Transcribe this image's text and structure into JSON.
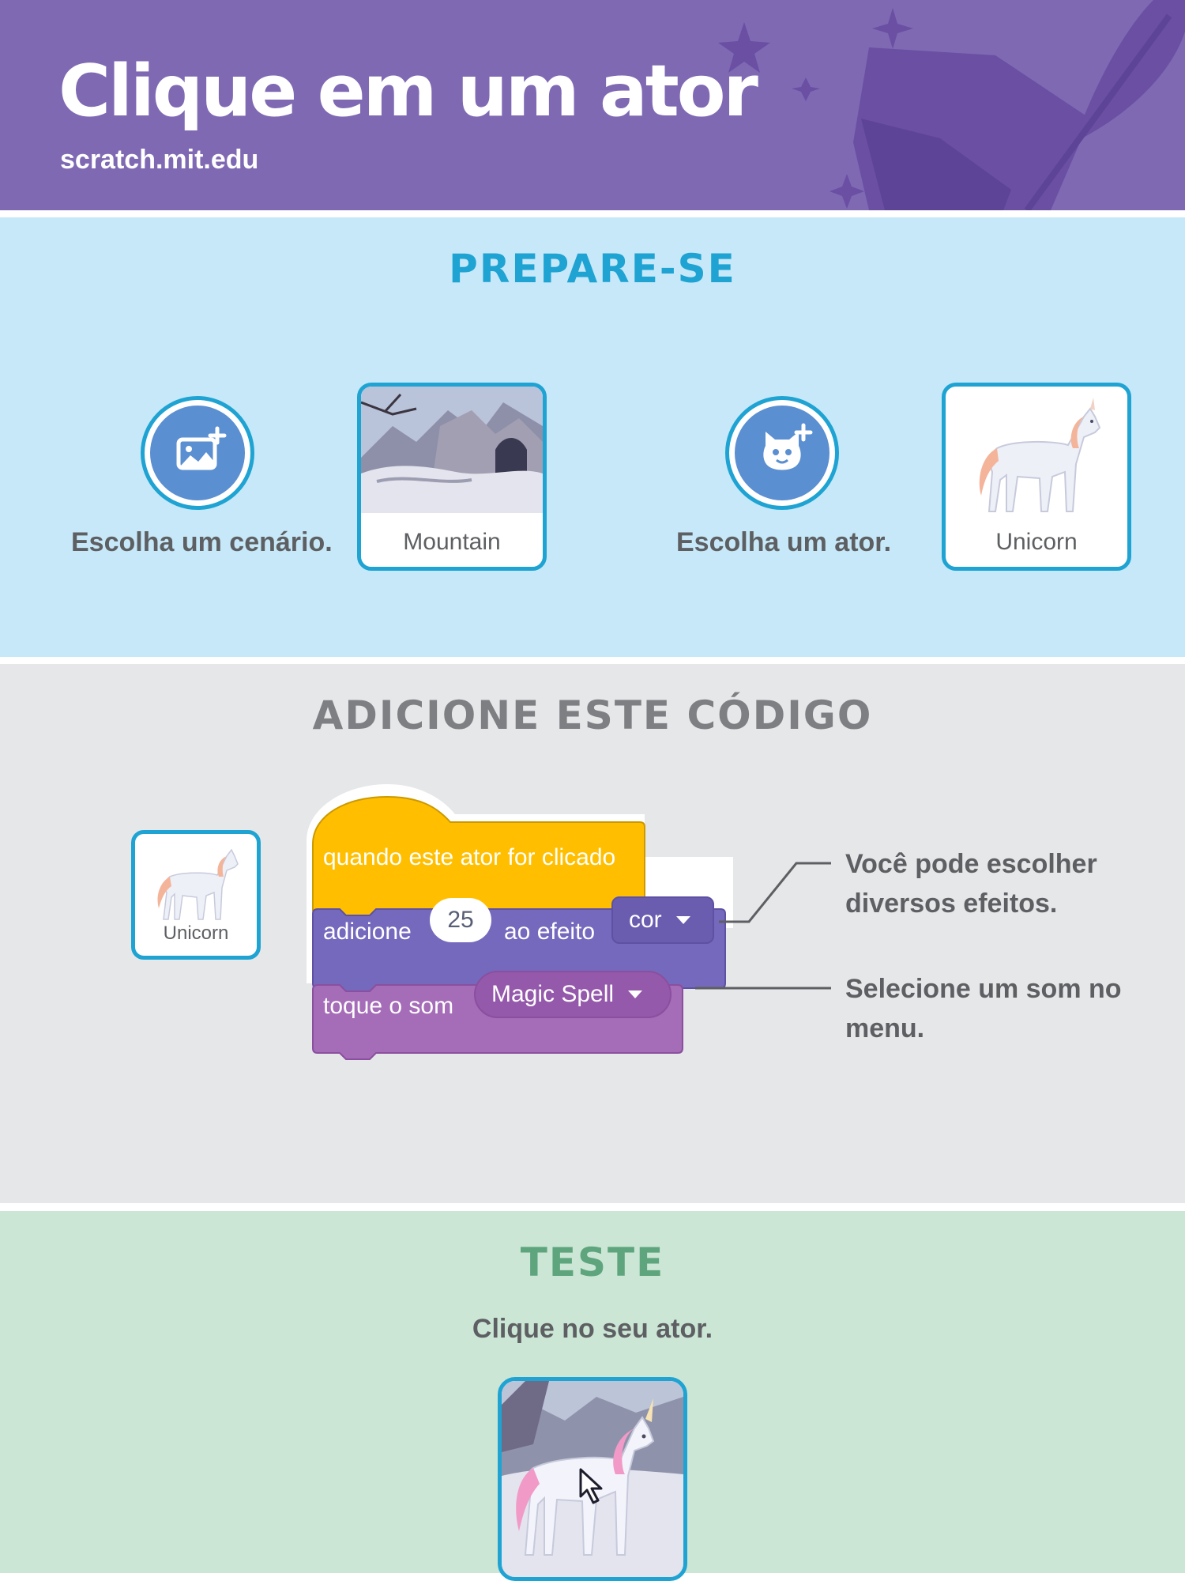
{
  "header": {
    "title": "Clique em um ator",
    "url": "scratch.mit.edu"
  },
  "colors": {
    "header_bg": "#7f69b3",
    "prep_bg": "#c6e8f8",
    "code_bg": "#e6e7e9",
    "test_bg": "#cce6d6",
    "accent_blue": "#1ea3d3",
    "events_yellow": "#ffbf00",
    "looks_purple": "#7569be",
    "sound_purple": "#a56cb8"
  },
  "prepare": {
    "heading": "PREPARE-SE",
    "backdrop_button_icon": "choose-backdrop-icon",
    "backdrop_caption": "Escolha um cenário.",
    "backdrop_thumb_label": "Mountain",
    "sprite_button_icon": "choose-sprite-icon",
    "sprite_caption": "Escolha um ator.",
    "sprite_thumb_label": "Unicorn"
  },
  "code": {
    "heading": "ADICIONE ESTE CÓDIGO",
    "sprite_thumb_label": "Unicorn",
    "hat_block": "quando este ator for clicado",
    "looks_block": {
      "prefix": "adicione",
      "value": "25",
      "middle": "ao efeito",
      "dropdown": "cor"
    },
    "sound_block": {
      "prefix": "toque o som",
      "dropdown": "Magic Spell"
    },
    "note_effects": [
      "Você pode escolher",
      "diversos efeitos."
    ],
    "note_sound": [
      "Selecione um som no",
      "menu."
    ]
  },
  "test": {
    "heading": "TESTE",
    "caption": "Clique no seu ator."
  }
}
